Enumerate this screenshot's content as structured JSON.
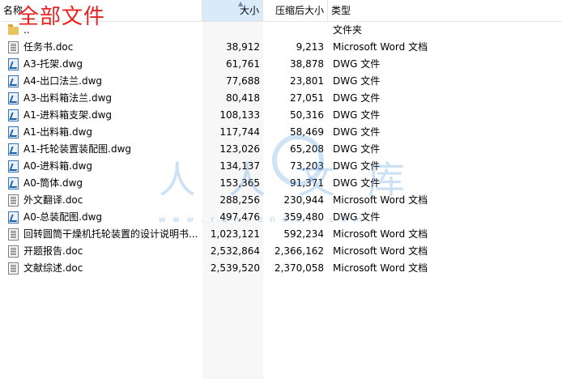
{
  "stamp": "全部文件",
  "header": {
    "name": "名称",
    "size": "大小",
    "compressed": "压缩后大小",
    "type": "类型"
  },
  "watermark": {
    "text": "人人文库",
    "url": "w w w . r e n r e n d o c . c o m"
  },
  "files": [
    {
      "icon": "folder-icon",
      "name": "..",
      "size": "",
      "compressed": "",
      "type": "文件夹"
    },
    {
      "icon": "word-doc-icon",
      "name": "任务书.doc",
      "size": "38,912",
      "compressed": "9,213",
      "type": "Microsoft Word 文档"
    },
    {
      "icon": "dwg-file-icon",
      "name": "A3-托架.dwg",
      "size": "61,761",
      "compressed": "38,878",
      "type": "DWG 文件"
    },
    {
      "icon": "dwg-file-icon",
      "name": "A4-出口法兰.dwg",
      "size": "77,688",
      "compressed": "23,801",
      "type": "DWG 文件"
    },
    {
      "icon": "dwg-file-icon",
      "name": "A3-出料箱法兰.dwg",
      "size": "80,418",
      "compressed": "27,051",
      "type": "DWG 文件"
    },
    {
      "icon": "dwg-file-icon",
      "name": "A1-进料箱支架.dwg",
      "size": "108,133",
      "compressed": "50,316",
      "type": "DWG 文件"
    },
    {
      "icon": "dwg-file-icon",
      "name": "A1-出料箱.dwg",
      "size": "117,744",
      "compressed": "58,469",
      "type": "DWG 文件"
    },
    {
      "icon": "dwg-file-icon",
      "name": "A1-托轮装置装配图.dwg",
      "size": "123,026",
      "compressed": "65,208",
      "type": "DWG 文件"
    },
    {
      "icon": "dwg-file-icon",
      "name": "A0-进料箱.dwg",
      "size": "134,137",
      "compressed": "73,203",
      "type": "DWG 文件"
    },
    {
      "icon": "dwg-file-icon",
      "name": "A0-筒体.dwg",
      "size": "153,365",
      "compressed": "91,371",
      "type": "DWG 文件"
    },
    {
      "icon": "word-doc-icon",
      "name": "外文翻译.doc",
      "size": "288,256",
      "compressed": "230,944",
      "type": "Microsoft Word 文档"
    },
    {
      "icon": "dwg-file-icon",
      "name": "A0-总装配图.dwg",
      "size": "497,476",
      "compressed": "359,480",
      "type": "DWG 文件"
    },
    {
      "icon": "word-doc-icon",
      "name": "回转圆筒干燥机托轮装置的设计说明书...",
      "size": "1,023,121",
      "compressed": "592,234",
      "type": "Microsoft Word 文档"
    },
    {
      "icon": "word-doc-icon",
      "name": "开题报告.doc",
      "size": "2,532,864",
      "compressed": "2,366,162",
      "type": "Microsoft Word 文档"
    },
    {
      "icon": "word-doc-icon",
      "name": "文献综述.doc",
      "size": "2,539,520",
      "compressed": "2,370,058",
      "type": "Microsoft Word 文档"
    }
  ]
}
